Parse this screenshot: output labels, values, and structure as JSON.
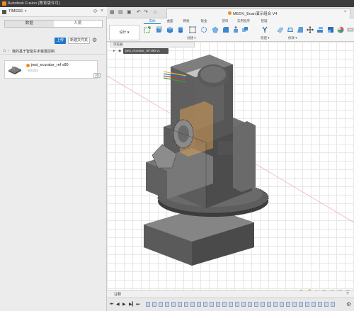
{
  "window": {
    "title": "Autodesk Fusion (教育版许可)"
  },
  "data_panel": {
    "team_name": "TIMEEE",
    "tabs": [
      {
        "label": "数据",
        "active": true
      },
      {
        "label": "人员",
        "active": false
      }
    ],
    "upload_label": "上传",
    "new_folder_label": "新建文件夹",
    "breadcrumb": "我的基于智能车手装置控制",
    "file": {
      "name": "jwst_ecurator_ref v80",
      "date": "9/23/24",
      "version": "V7"
    }
  },
  "document": {
    "tab_name": "MEGV_Euan演示组合 V4"
  },
  "ribbon": {
    "workspace_label": "设计 ▾",
    "tabs": [
      "实体",
      "曲面",
      "网格",
      "钣金",
      "塑料",
      "实用程序",
      "管理"
    ],
    "active_tab": "实体",
    "groups": [
      "创建 ▾",
      "修改 ▾",
      "装配 ▾"
    ]
  },
  "browser": {
    "header": "浏览器",
    "root_component": "jwst_ecurator_ref v80 v1"
  },
  "comments": {
    "label": "注释"
  },
  "colors": {
    "accent": "#1f76c8",
    "brand_orange": "#f08a24",
    "titlebar": "#3c3c3c"
  }
}
